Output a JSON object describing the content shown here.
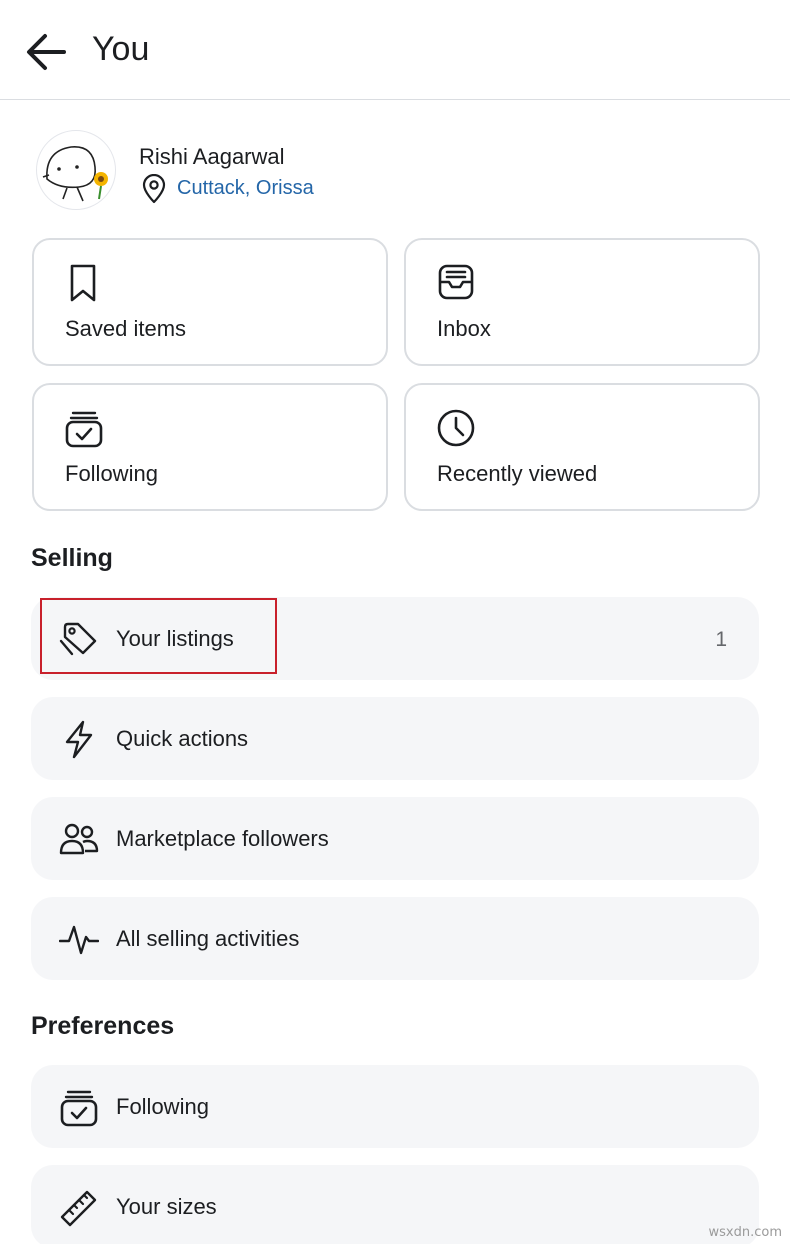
{
  "header": {
    "title": "You",
    "back_icon": "arrow-left-icon"
  },
  "profile": {
    "name": "Rishi Aagarwal",
    "location": "Cuttack, Orissa",
    "location_color": "#2466a8"
  },
  "tiles": [
    {
      "label": "Saved items",
      "icon": "bookmark-icon"
    },
    {
      "label": "Inbox",
      "icon": "inbox-icon"
    },
    {
      "label": "Following",
      "icon": "following-box-icon"
    },
    {
      "label": "Recently viewed",
      "icon": "clock-icon"
    }
  ],
  "selling": {
    "title": "Selling",
    "items": [
      {
        "label": "Your listings",
        "icon": "price-tag-icon",
        "count": "1"
      },
      {
        "label": "Quick actions",
        "icon": "lightning-icon"
      },
      {
        "label": "Marketplace followers",
        "icon": "people-icon"
      },
      {
        "label": "All selling activities",
        "icon": "activity-pulse-icon"
      }
    ]
  },
  "preferences": {
    "title": "Preferences",
    "items": [
      {
        "label": "Following",
        "icon": "following-box-icon"
      },
      {
        "label": "Your sizes",
        "icon": "ruler-icon"
      }
    ]
  },
  "colors": {
    "highlight": "#c8202b",
    "row_bg": "#f5f6f8",
    "tile_border": "#dadde1"
  },
  "watermark": "wsxdn.com"
}
